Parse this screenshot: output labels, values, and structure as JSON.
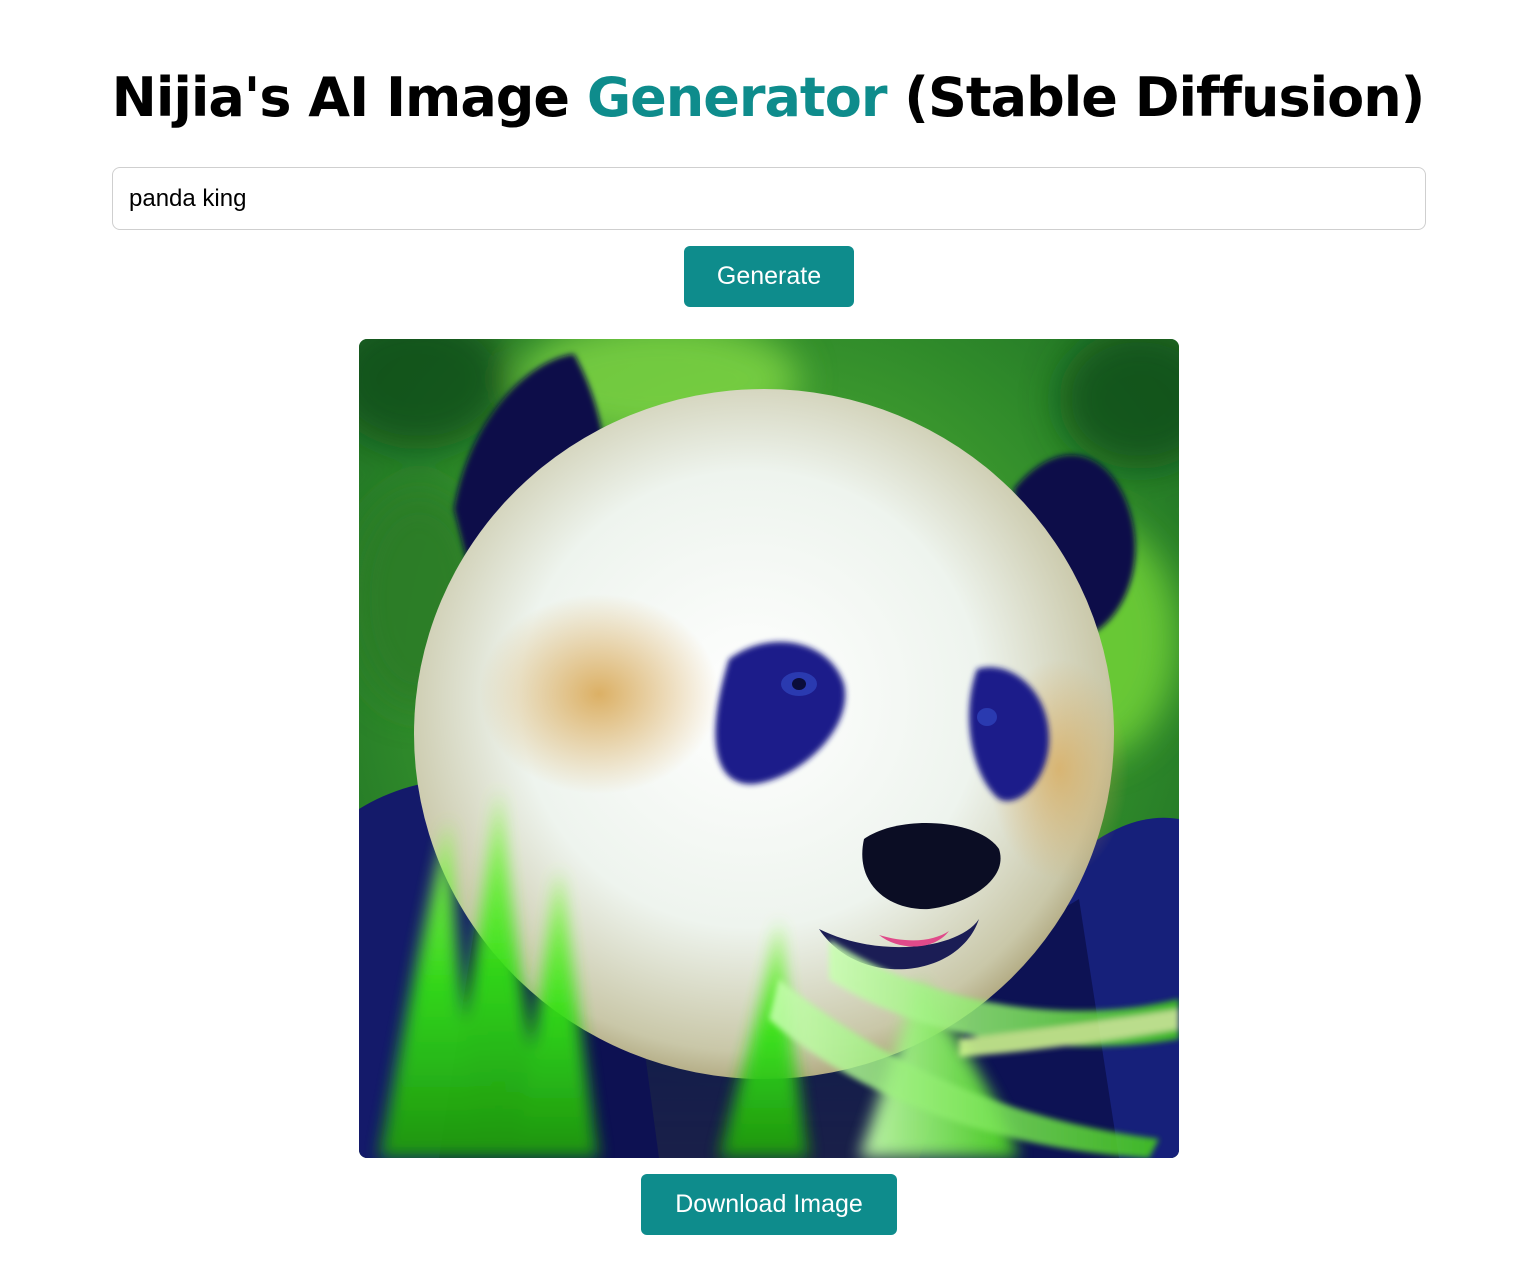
{
  "header": {
    "title_before": "Nijia's AI Image ",
    "title_accent": "Generator",
    "title_after": " (Stable Diffusion)",
    "accent_color": "#0e8c8c"
  },
  "prompt": {
    "value": "panda king"
  },
  "actions": {
    "generate_label": "Generate",
    "download_label": "Download Image",
    "button_color": "#0e8c8c"
  },
  "result": {
    "image_subject": "panda-image"
  }
}
